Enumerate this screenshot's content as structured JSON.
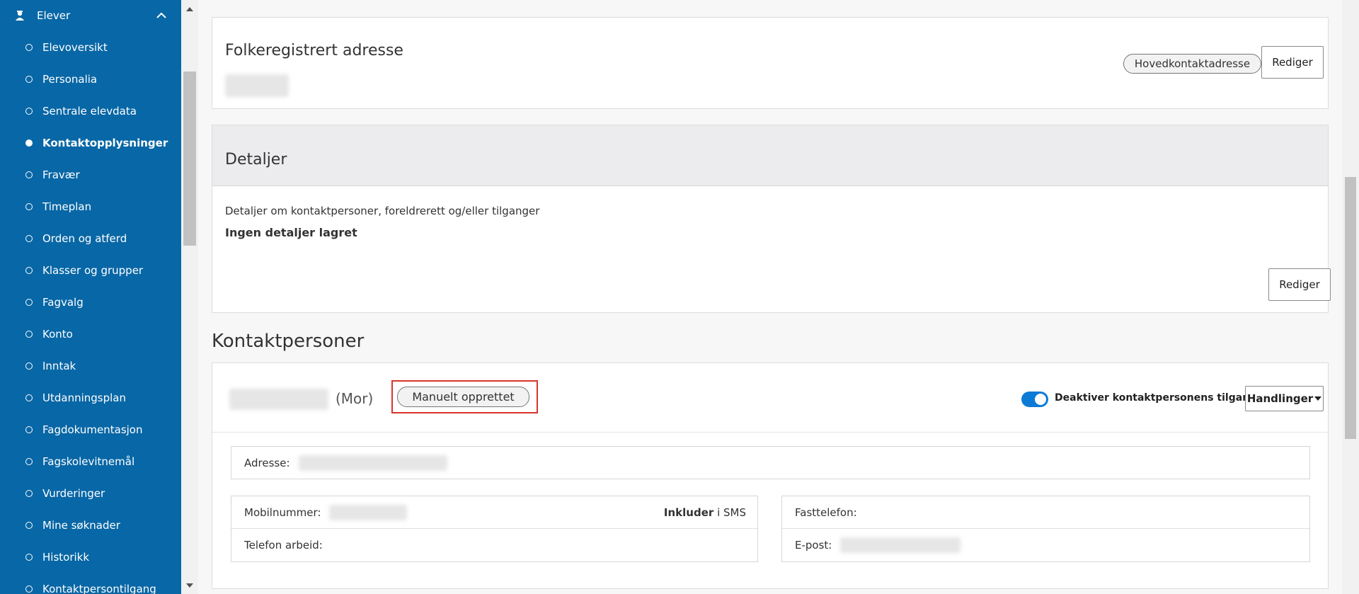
{
  "sidebar": {
    "header_label": "Elever",
    "items": [
      {
        "label": "Elevoversikt",
        "active": false
      },
      {
        "label": "Personalia",
        "active": false
      },
      {
        "label": "Sentrale elevdata",
        "active": false
      },
      {
        "label": "Kontaktopplysninger",
        "active": true
      },
      {
        "label": "Fravær",
        "active": false
      },
      {
        "label": "Timeplan",
        "active": false
      },
      {
        "label": "Orden og atferd",
        "active": false
      },
      {
        "label": "Klasser og grupper",
        "active": false
      },
      {
        "label": "Fagvalg",
        "active": false
      },
      {
        "label": "Konto",
        "active": false
      },
      {
        "label": "Inntak",
        "active": false
      },
      {
        "label": "Utdanningsplan",
        "active": false
      },
      {
        "label": "Fagdokumentasjon",
        "active": false
      },
      {
        "label": "Fagskolevitnemål",
        "active": false
      },
      {
        "label": "Vurderinger",
        "active": false
      },
      {
        "label": "Mine søknader",
        "active": false
      },
      {
        "label": "Historikk",
        "active": false
      },
      {
        "label": "Kontaktpersontilgang",
        "active": false
      }
    ],
    "icons": {
      "header": "student-icon",
      "collapse": "chevron-up-icon"
    },
    "bg_color": "#0867a6"
  },
  "address_card": {
    "title": "Folkeregistrert adresse",
    "badge": "Hovedkontaktadresse",
    "edit_label": "Rediger"
  },
  "details_card": {
    "title": "Detaljer",
    "description": "Detaljer om kontaktpersoner, foreldrerett og/eller tilganger",
    "empty_text": "Ingen detaljer lagret",
    "edit_label": "Rediger"
  },
  "contacts": {
    "section_title": "Kontaktpersoner",
    "person": {
      "relation": "(Mor)",
      "badge": "Manuelt opprettet",
      "toggle_label": "Deaktiver kontaktpersonens tilgang",
      "toggle_on": true,
      "actions_label": "Handlinger",
      "address_label": "Adresse:",
      "mobile_label": "Mobilnummer:",
      "sms_include": "Inkluder",
      "sms_suffix": "i SMS",
      "work_phone_label": "Telefon arbeid:",
      "landline_label": "Fasttelefon:",
      "email_label": "E-post:"
    }
  },
  "colors": {
    "accent": "#0c7bd6",
    "highlight": "#d9342b"
  }
}
